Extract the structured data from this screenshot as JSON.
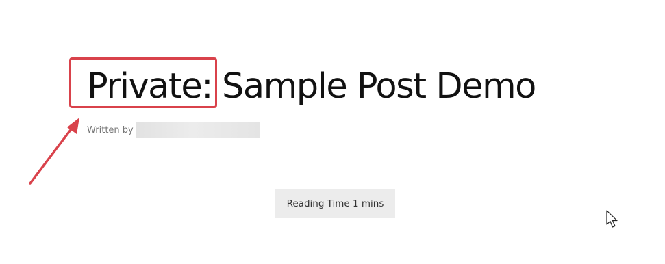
{
  "post": {
    "private_prefix": "Private:",
    "title": "Sample Post Demo",
    "byline_label": "Written by",
    "reading_time": "Reading Time 1 mins"
  },
  "annotation": {
    "highlight_color": "#d9424b"
  },
  "icons": {
    "pointer": "mouse-pointer-icon",
    "arrow": "annotation-arrow-icon"
  }
}
